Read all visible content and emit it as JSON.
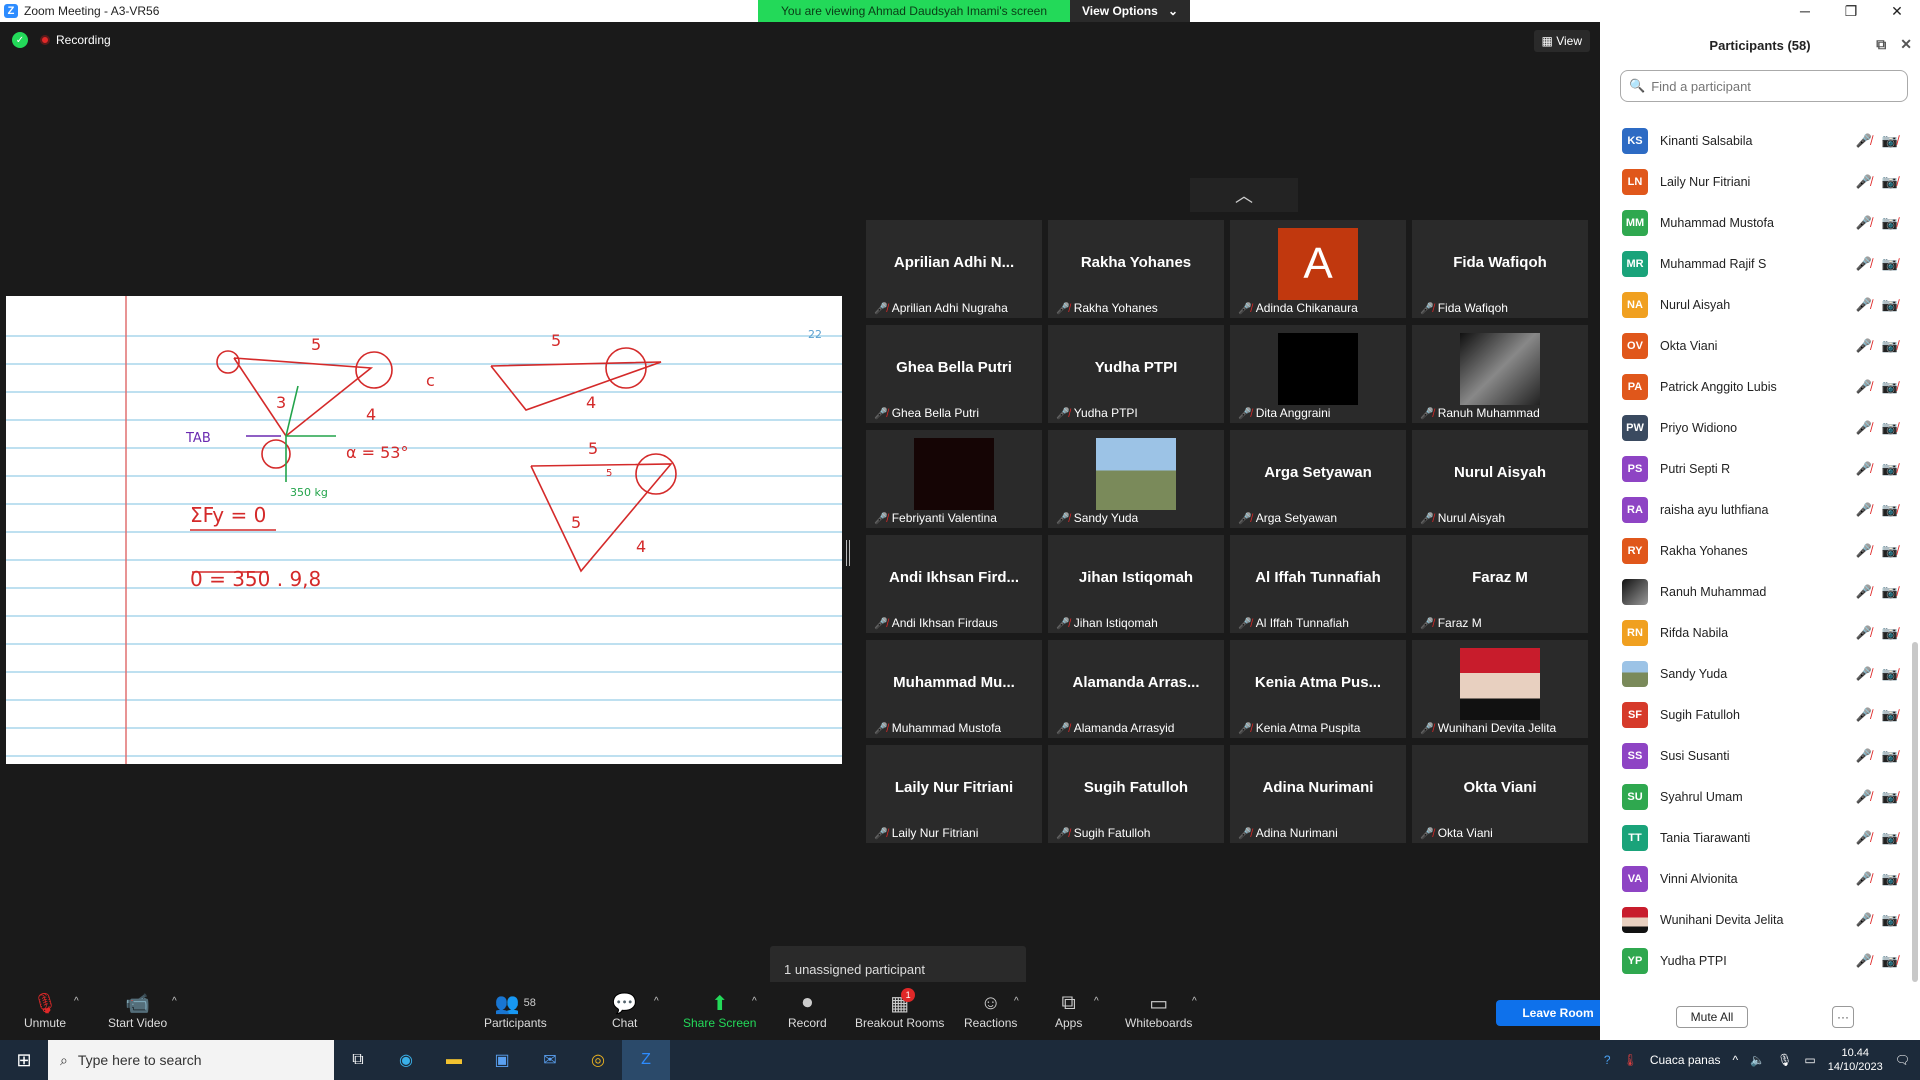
{
  "window": {
    "title": "Zoom Meeting - A3-VR56",
    "app_icon": "Z"
  },
  "banner": {
    "viewing_text": "You are viewing Ahmad Daudsyah Imami's screen",
    "view_options": "View Options"
  },
  "status": {
    "recording": "Recording"
  },
  "view_button": "View",
  "shared_screen": {
    "page_number": "22",
    "whiteboard_texts": [
      "5",
      "5",
      "c",
      "3",
      "4",
      "α = 53°",
      "TAB",
      "350 kg",
      "ΣFy = 0",
      "0 = 350 . 9,8",
      "5",
      "4",
      "5",
      "5",
      "4"
    ]
  },
  "tiles": [
    {
      "big": "Aprilian Adhi N...",
      "name": "Aprilian Adhi Nugraha"
    },
    {
      "big": "Rakha Yohanes",
      "name": "Rakha Yohanes"
    },
    {
      "avatar_letter": "A",
      "name": "Adinda Chikanaura"
    },
    {
      "big": "Fida Wafiqoh",
      "name": "Fida Wafiqoh"
    },
    {
      "big": "Ghea Bella Putri",
      "name": "Ghea Bella Putri"
    },
    {
      "big": "Yudha PTPI",
      "name": "Yudha PTPI"
    },
    {
      "video": "black",
      "name": "Dita Anggraini"
    },
    {
      "video": "photo-chess",
      "name": "Ranuh Muhammad"
    },
    {
      "video": "dark",
      "name": "Febriyanti Valentina"
    },
    {
      "video": "photo-field",
      "name": "Sandy Yuda"
    },
    {
      "big": "Arga Setyawan",
      "name": "Arga Setyawan"
    },
    {
      "big": "Nurul Aisyah",
      "name": "Nurul Aisyah"
    },
    {
      "big": "Andi Ikhsan Fird...",
      "name": "Andi Ikhsan Firdaus"
    },
    {
      "big": "Jihan Istiqomah",
      "name": "Jihan Istiqomah"
    },
    {
      "big": "Al Iffah Tunnafiah",
      "name": "Al Iffah Tunnafiah"
    },
    {
      "big": "Faraz M",
      "name": "Faraz M"
    },
    {
      "big": "Muhammad Mu...",
      "name": "Muhammad Mustofa"
    },
    {
      "big": "Alamanda Arras...",
      "name": "Alamanda Arrasyid"
    },
    {
      "big": "Kenia Atma Pus...",
      "name": "Kenia Atma Puspita"
    },
    {
      "video": "photo-hijab",
      "name": "Wunihani Devita Jelita"
    },
    {
      "big": "Laily Nur Fitriani",
      "name": "Laily Nur Fitriani"
    },
    {
      "big": "Sugih Fatulloh",
      "name": "Sugih Fatulloh"
    },
    {
      "big": "Adina Nurimani",
      "name": "Adina Nurimani"
    },
    {
      "big": "Okta Viani",
      "name": "Okta Viani"
    }
  ],
  "unassigned": "1 unassigned participant",
  "toolbar": {
    "unmute": "Unmute",
    "start_video": "Start Video",
    "participants": "Participants",
    "participants_count": "58",
    "chat": "Chat",
    "share_screen": "Share Screen",
    "record": "Record",
    "breakout_rooms": "Breakout Rooms",
    "breakout_badge": "1",
    "reactions": "Reactions",
    "apps": "Apps",
    "whiteboards": "Whiteboards",
    "leave_room": "Leave Room"
  },
  "panel": {
    "title": "Participants (58)",
    "search_placeholder": "Find a participant",
    "participants": [
      {
        "initials": "KS",
        "name": "Kinanti Salsabila",
        "color": "#2d6bc4"
      },
      {
        "initials": "LN",
        "name": "Laily Nur Fitriani",
        "color": "#e0571b"
      },
      {
        "initials": "MM",
        "name": "Muhammad Mustofa",
        "color": "#2fa84f"
      },
      {
        "initials": "MR",
        "name": "Muhammad Rajif S",
        "color": "#1aa37a"
      },
      {
        "initials": "NA",
        "name": "Nurul Aisyah",
        "color": "#f0a020"
      },
      {
        "initials": "OV",
        "name": "Okta Viani",
        "color": "#e0571b"
      },
      {
        "initials": "PA",
        "name": "Patrick Anggito Lubis",
        "color": "#e0571b"
      },
      {
        "initials": "PW",
        "name": "Priyo Widiono",
        "color": "#3a4a60"
      },
      {
        "initials": "PS",
        "name": "Putri Septi R",
        "color": "#8e44c4"
      },
      {
        "initials": "RA",
        "name": "raisha ayu luthfiana",
        "color": "#8e44c4"
      },
      {
        "initials": "RY",
        "name": "Rakha Yohanes",
        "color": "#e0571b"
      },
      {
        "initials": "",
        "name": "Ranuh Muhammad",
        "color": "#444444"
      },
      {
        "initials": "RN",
        "name": "Rifda Nabila",
        "color": "#f0a020"
      },
      {
        "initials": "",
        "name": "Sandy Yuda",
        "color": "#6a8fb0"
      },
      {
        "initials": "SF",
        "name": "Sugih Fatulloh",
        "color": "#d63a2a"
      },
      {
        "initials": "SS",
        "name": "Susi Susanti",
        "color": "#8e44c4"
      },
      {
        "initials": "SU",
        "name": "Syahrul Umam",
        "color": "#2fa84f"
      },
      {
        "initials": "TT",
        "name": "Tania Tiarawanti",
        "color": "#1aa37a"
      },
      {
        "initials": "VA",
        "name": "Vinni Alvionita",
        "color": "#8e44c4"
      },
      {
        "initials": "",
        "name": "Wunihani Devita Jelita",
        "color": "#c0392b"
      },
      {
        "initials": "YP",
        "name": "Yudha PTPI",
        "color": "#2fa84f"
      }
    ],
    "mute_all": "Mute All",
    "more": "···"
  },
  "taskbar": {
    "search_placeholder": "Type here to search",
    "weather": "Cuaca panas",
    "time": "10.44",
    "date": "14/10/2023"
  }
}
